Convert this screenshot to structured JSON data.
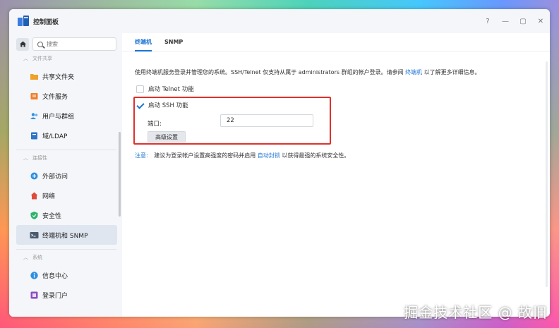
{
  "window": {
    "title": "控制面板",
    "controls": [
      "?",
      "—",
      "▢",
      "✕"
    ]
  },
  "sidebar": {
    "search_placeholder": "搜索",
    "groups": [
      {
        "label": "文件共享",
        "items": [
          {
            "label": "共享文件夹",
            "icon": "shared-folder-icon",
            "color": "#f0a12b"
          },
          {
            "label": "文件服务",
            "icon": "file-services-icon",
            "color": "#f07f2b"
          },
          {
            "label": "用户与群组",
            "icon": "user-group-icon",
            "color": "#2f8fe0"
          },
          {
            "label": "域/LDAP",
            "icon": "domain-ldap-icon",
            "color": "#2f74c8"
          }
        ]
      },
      {
        "label": "连接性",
        "items": [
          {
            "label": "外部访问",
            "icon": "external-access-icon",
            "color": "#2f8fe0"
          },
          {
            "label": "网络",
            "icon": "network-icon",
            "color": "#e04a3a"
          },
          {
            "label": "安全性",
            "icon": "security-shield-icon",
            "color": "#2cb36b"
          },
          {
            "label": "终端机和 SNMP",
            "icon": "terminal-icon",
            "color": "#4a5b6e",
            "active": true
          }
        ]
      },
      {
        "label": "系统",
        "items": [
          {
            "label": "信息中心",
            "icon": "info-center-icon",
            "color": "#2f8fe0"
          },
          {
            "label": "登录门户",
            "icon": "login-portal-icon",
            "color": "#8b4fc4"
          }
        ]
      }
    ]
  },
  "main": {
    "tabs": [
      {
        "label": "终端机",
        "active": true
      },
      {
        "label": "SNMP",
        "active": false
      }
    ],
    "description_prefix": "使用终端机服务登录并管理您的系统。SSH/Telnet 仅支持从属于 administrators 群组的帐户登录。请参阅",
    "description_link": "终端机",
    "description_suffix": "以了解更多详细信息。",
    "telnet_label": "启动 Telnet 功能",
    "telnet_checked": false,
    "ssh_label": "启动 SSH 功能",
    "ssh_checked": true,
    "port_label": "端口:",
    "port_value": "22",
    "advanced_button": "高级设置",
    "note_label": "注意:",
    "note_prefix": "建议为登录帐户设置高强度的密码并启用",
    "note_link": "自动封锁",
    "note_suffix": "以获得最强的系统安全性。"
  },
  "watermark": "掘金技术社区 @ 故旧",
  "colors": {
    "accent": "#1d74d3",
    "highlight_box": "#e0312b",
    "sidebar_bg": "#f4f6f9"
  }
}
